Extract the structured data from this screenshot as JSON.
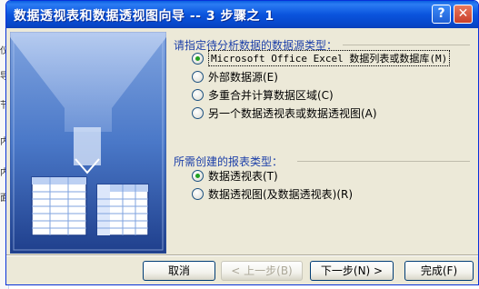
{
  "background_strip": {
    "marks": [
      "仪",
      "导",
      "节",
      "内",
      "内",
      "面"
    ]
  },
  "window": {
    "title": "数据透视表和数据透视图向导 -- 3 步骤之 1",
    "help_label": "?",
    "close_label": "✕"
  },
  "data_source": {
    "heading": "请指定待分析数据的数据源类型：",
    "options": [
      {
        "label": "Microsoft Office Excel 数据列表或数据库(M)",
        "checked": true
      },
      {
        "label": "外部数据源(E)",
        "checked": false
      },
      {
        "label": "多重合并计算数据区域(C)",
        "checked": false
      },
      {
        "label": "另一个数据透视表或数据透视图(A)",
        "checked": false
      }
    ]
  },
  "report_type": {
    "heading": "所需创建的报表类型：",
    "options": [
      {
        "label": "数据透视表(T)",
        "checked": true
      },
      {
        "label": "数据透视图(及数据透视表)(R)",
        "checked": false
      }
    ]
  },
  "buttons": {
    "cancel": "取消",
    "back": "< 上一步(B)",
    "next": "下一步(N) >",
    "finish": "完成(F)"
  },
  "colors": {
    "titlebar": "#0a54dd",
    "accent_text": "#1c3fa8",
    "dialog_bg": "#ece9d8"
  }
}
